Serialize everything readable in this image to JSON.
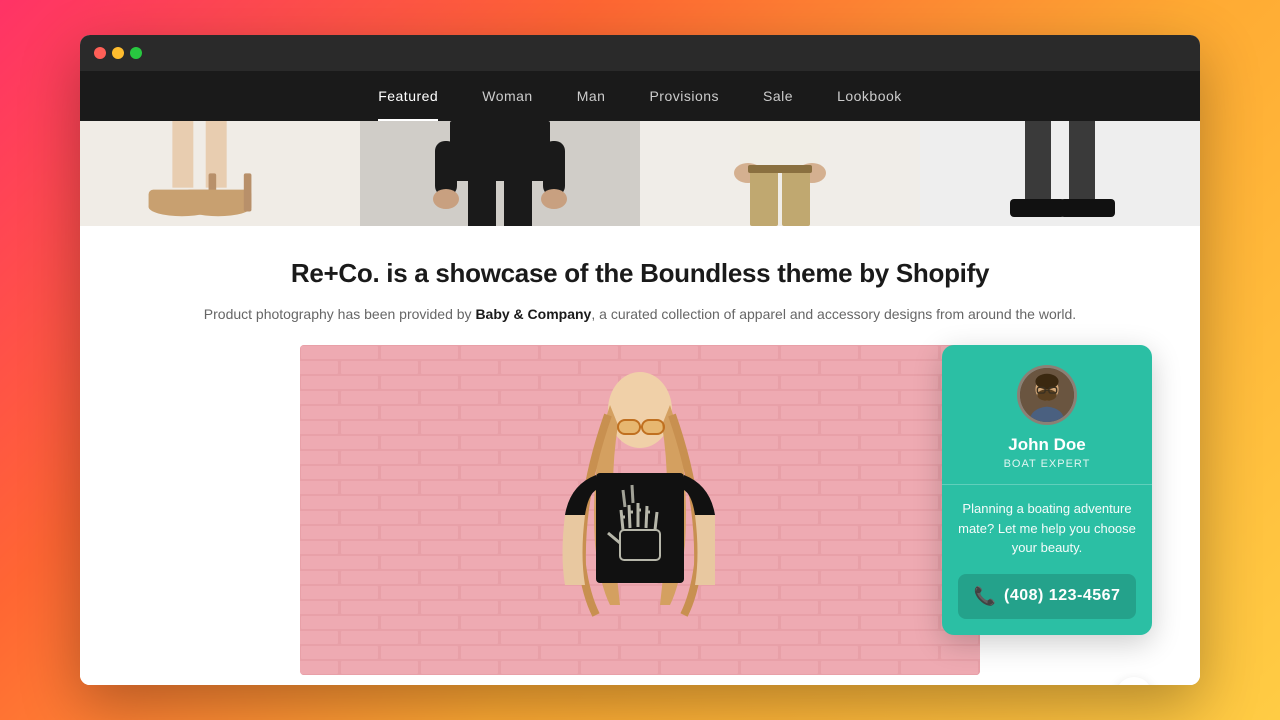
{
  "browser": {
    "dots": [
      "red",
      "yellow",
      "green"
    ]
  },
  "nav": {
    "items": [
      {
        "label": "Featured",
        "active": true
      },
      {
        "label": "Woman",
        "active": false
      },
      {
        "label": "Man",
        "active": false
      },
      {
        "label": "Provisions",
        "active": false
      },
      {
        "label": "Sale",
        "active": false
      },
      {
        "label": "Lookbook",
        "active": false
      }
    ]
  },
  "main": {
    "title": "Re+Co. is a showcase of the Boundless theme by Shopify",
    "subtitle_before": "Product photography has been provided by ",
    "subtitle_brand": "Baby & Company",
    "subtitle_after": ", a curated collection of apparel and accessory designs from around the world."
  },
  "chat_widget": {
    "name": "John Doe",
    "role": "BOAT EXPERT",
    "message": "Planning a boating adventure mate? Let me help you choose your beauty.",
    "phone": "(408) 123-4567"
  }
}
